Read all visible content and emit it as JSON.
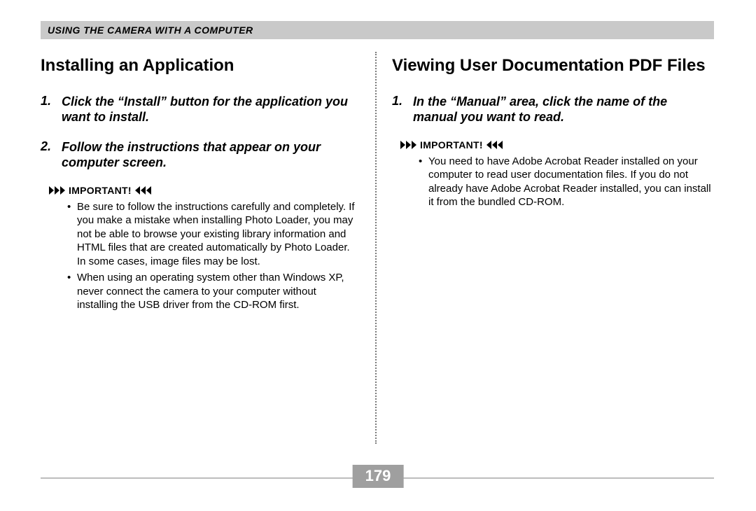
{
  "header": {
    "section_title": "USING THE CAMERA WITH A COMPUTER"
  },
  "left": {
    "heading": "Installing an Application",
    "steps": [
      {
        "num": "1.",
        "text": "Click the “Install” button for the application you want to install."
      },
      {
        "num": "2.",
        "text": "Follow the instructions that appear on your computer screen."
      }
    ],
    "important_label": "IMPORTANT!",
    "bullets": [
      "Be sure to follow the instructions carefully and completely. If you make a mistake when installing Photo Loader, you may not be able to browse your existing library information and HTML files that are created automatically by Photo Loader. In some cases, image files may be lost.",
      "When using an operating system other than Windows XP, never connect the camera to your computer without installing the USB driver from the CD-ROM first."
    ]
  },
  "right": {
    "heading": "Viewing User Documentation PDF Files",
    "steps": [
      {
        "num": "1.",
        "text": "In the “Manual” area, click the name of the manual you want to read."
      }
    ],
    "important_label": "IMPORTANT!",
    "bullets": [
      "You need to have Adobe Acrobat Reader installed on your computer to read user documentation files. If you do not already have Adobe Acrobat Reader installed, you can install it from the bundled CD-ROM."
    ]
  },
  "page_number": "179"
}
